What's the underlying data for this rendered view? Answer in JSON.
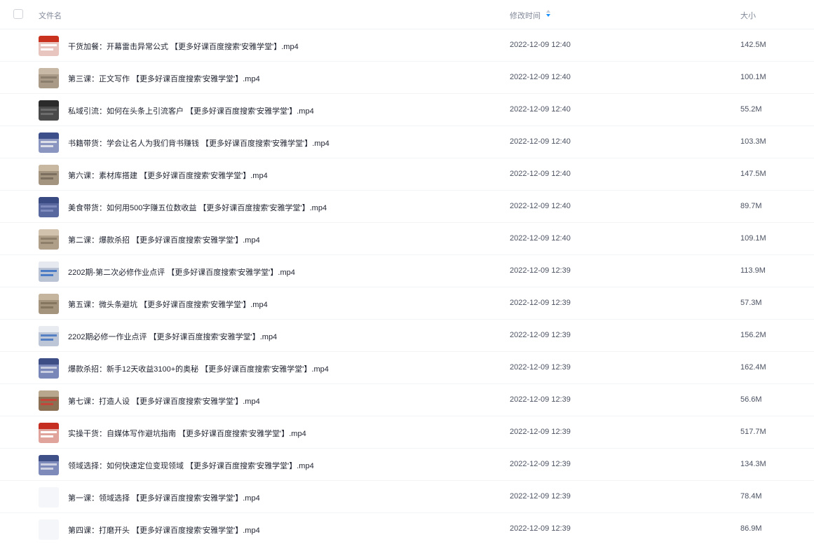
{
  "header": {
    "name_label": "文件名",
    "time_label": "修改时间",
    "size_label": "大小",
    "sort_icon": "sort-icon",
    "sort_color": "#1890ff"
  },
  "files": [
    {
      "name": "干货加餐：开幕雷击异常公式 【更多好课百度搜索'安雅学堂'】.mp4",
      "time": "2022-12-09 12:40",
      "size": "142.5M",
      "thumb": [
        "#c8321e",
        "#ffffff",
        "#e8c6bf"
      ]
    },
    {
      "name": "第三课：正文写作 【更多好课百度搜索'安雅学堂'】.mp4",
      "time": "2022-12-09 12:40",
      "size": "100.1M",
      "thumb": [
        "#c7b9a5",
        "#8c7e6c",
        "#a89a86"
      ]
    },
    {
      "name": "私域引流：如何在头条上引流客户 【更多好课百度搜索'安雅学堂'】.mp4",
      "time": "2022-12-09 12:40",
      "size": "55.2M",
      "thumb": [
        "#2b2b2b",
        "#6c6c6c",
        "#4a4a4a"
      ]
    },
    {
      "name": "书籍带货：学会让名人为我们背书赚钱 【更多好课百度搜索'安雅学堂'】.mp4",
      "time": "2022-12-09 12:40",
      "size": "103.3M",
      "thumb": [
        "#3d4f8a",
        "#dcdfe8",
        "#8a96c0"
      ]
    },
    {
      "name": "第六课：素材库搭建 【更多好课百度搜索'安雅学堂'】.mp4",
      "time": "2022-12-09 12:40",
      "size": "147.5M",
      "thumb": [
        "#c8b8a2",
        "#7d6f5f",
        "#a3947f"
      ]
    },
    {
      "name": "美食带货：如何用500字赚五位数收益 【更多好课百度搜索'安雅学堂'】.mp4",
      "time": "2022-12-09 12:40",
      "size": "89.7M",
      "thumb": [
        "#3a4a82",
        "#7f8bbd",
        "#5a68a0"
      ]
    },
    {
      "name": "第二课：爆款杀招 【更多好课百度搜索'安雅学堂'】.mp4",
      "time": "2022-12-09 12:40",
      "size": "109.1M",
      "thumb": [
        "#d0c2ac",
        "#8e7f6b",
        "#b09f88"
      ]
    },
    {
      "name": "2202期-第二次必修作业点评 【更多好课百度搜索'安雅学堂'】.mp4",
      "time": "2022-12-09 12:39",
      "size": "113.9M",
      "thumb": [
        "#e6e9ef",
        "#4d7cc7",
        "#b9c3d4"
      ]
    },
    {
      "name": "第五课：微头条避坑 【更多好课百度搜索'安雅学堂'】.mp4",
      "time": "2022-12-09 12:39",
      "size": "57.3M",
      "thumb": [
        "#c5b59e",
        "#857660",
        "#a4947d"
      ]
    },
    {
      "name": "2202期必修一作业点评 【更多好课百度搜索'安雅学堂'】.mp4",
      "time": "2022-12-09 12:39",
      "size": "156.2M",
      "thumb": [
        "#e8ebf0",
        "#5580c4",
        "#bcc6d6"
      ]
    },
    {
      "name": "爆款杀招：新手12天收益3100+的奥秘 【更多好课百度搜索'安雅学堂'】.mp4",
      "time": "2022-12-09 12:39",
      "size": "162.4M",
      "thumb": [
        "#3d4d86",
        "#c9cde0",
        "#7986b8"
      ]
    },
    {
      "name": "第七课：打造人设 【更多好课百度搜索'安雅学堂'】.mp4",
      "time": "2022-12-09 12:39",
      "size": "56.6M",
      "thumb": [
        "#b8a68d",
        "#c4453a",
        "#8a6f52"
      ]
    },
    {
      "name": "实操干货：自媒体写作避坑指南 【更多好课百度搜索'安雅学堂'】.mp4",
      "time": "2022-12-09 12:39",
      "size": "517.7M",
      "thumb": [
        "#c42d1f",
        "#ffffff",
        "#e0a49c"
      ]
    },
    {
      "name": "领域选择：如何快速定位变现领域 【更多好课百度搜索'安雅学堂'】.mp4",
      "time": "2022-12-09 12:39",
      "size": "134.3M",
      "thumb": [
        "#3f4f88",
        "#cdd1e2",
        "#7d8aba"
      ]
    },
    {
      "name": "第一课：领域选择 【更多好课百度搜索'安雅学堂'】.mp4",
      "time": "2022-12-09 12:39",
      "size": "78.4M",
      "thumb": [
        "#f5f6fa",
        "#f5f6fa",
        "#f5f6fa"
      ]
    },
    {
      "name": "第四课：打磨开头 【更多好课百度搜索'安雅学堂'】.mp4",
      "time": "2022-12-09 12:39",
      "size": "86.9M",
      "thumb": [
        "#f5f6fa",
        "#f5f6fa",
        "#f5f6fa"
      ]
    }
  ]
}
